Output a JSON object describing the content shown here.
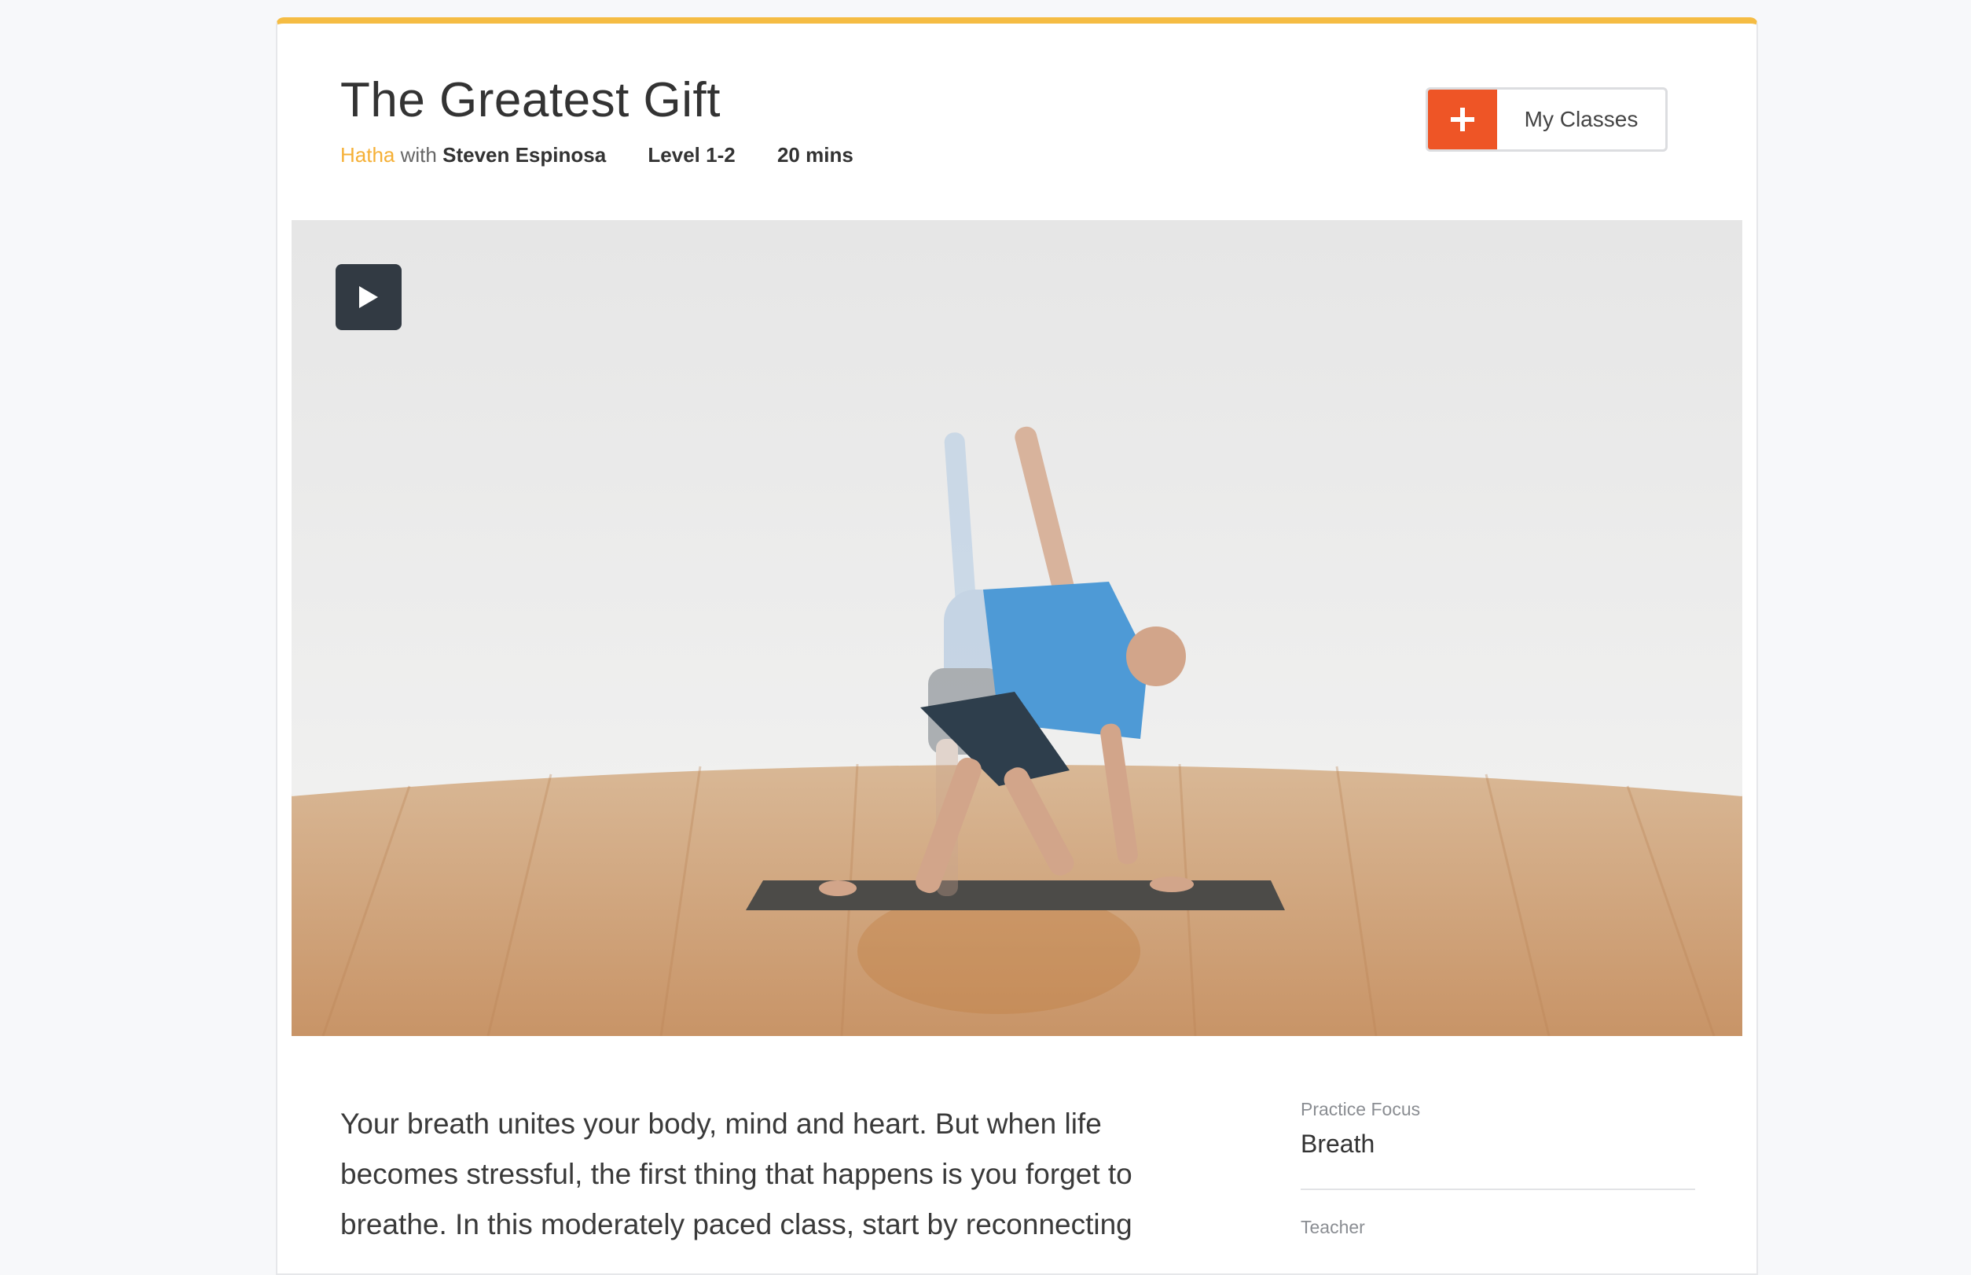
{
  "class": {
    "title": "The Greatest Gift",
    "style": "Hatha",
    "with_text": "with",
    "teacher": "Steven Espinosa",
    "level": "Level 1-2",
    "duration": "20 mins"
  },
  "actions": {
    "add_label": "My Classes"
  },
  "description": "Your breath unites your body, mind and heart. But when life becomes stressful, the first thing that happens is you forget to breathe. In this moderately paced class, start by reconnecting",
  "details": {
    "practice_focus_label": "Practice Focus",
    "practice_focus_value": "Breath",
    "teacher_label": "Teacher"
  },
  "colors": {
    "accent": "#f5bc43",
    "add_button": "#ee5526",
    "play_button": "#323a43"
  },
  "icons": {
    "add": "plus-icon",
    "play": "play-icon"
  }
}
